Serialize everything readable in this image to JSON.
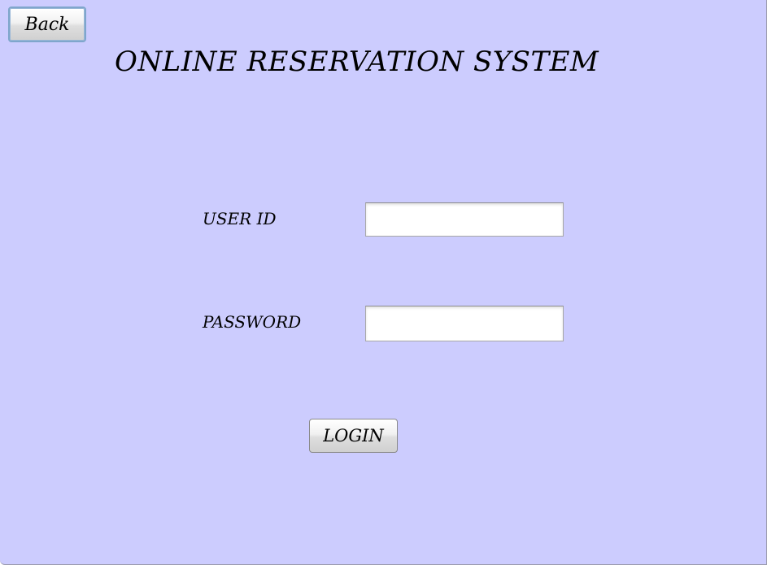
{
  "header": {
    "back_label": "Back",
    "title": "ONLINE RESERVATION SYSTEM"
  },
  "form": {
    "user_id_label": "USER ID",
    "user_id_value": "",
    "password_label": "PASSWORD",
    "password_value": "",
    "login_label": "LOGIN"
  },
  "colors": {
    "background": "#ccccfe"
  }
}
